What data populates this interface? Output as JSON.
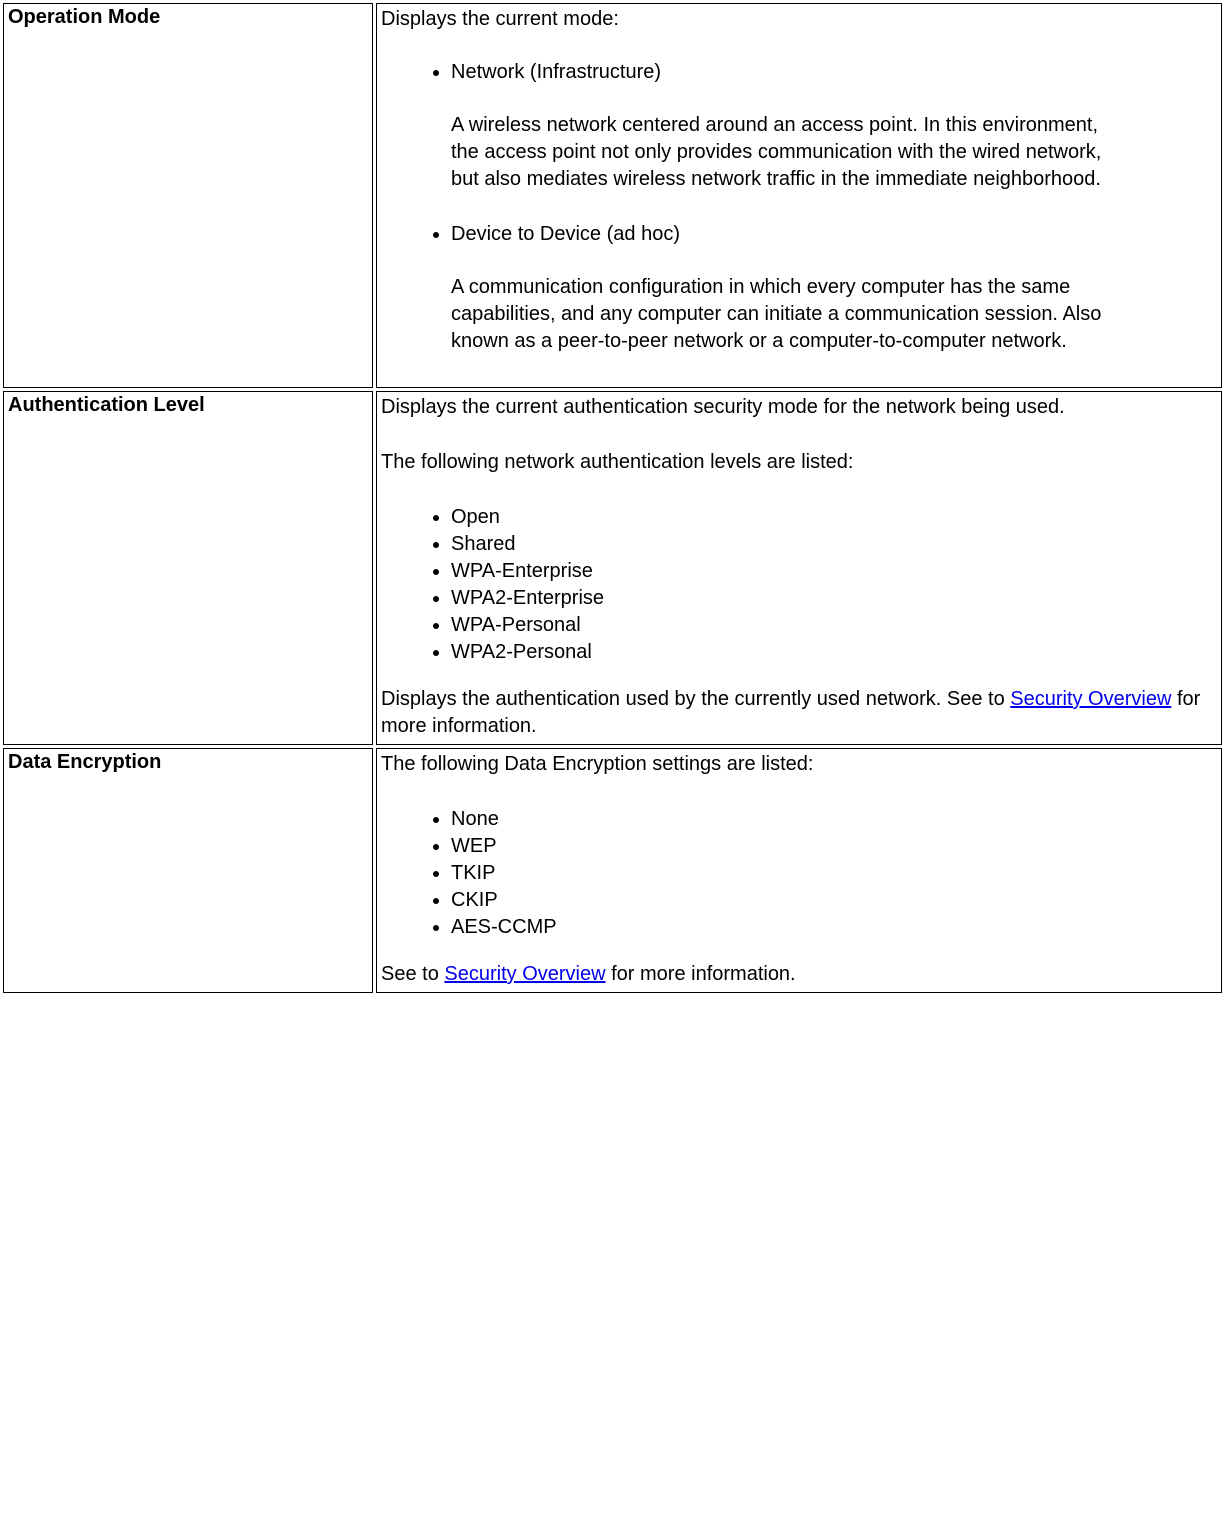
{
  "rows": [
    {
      "label": "Operation Mode",
      "intro": "Displays the current mode:",
      "items": [
        {
          "title": "Network (Infrastructure)",
          "desc": "A wireless network centered around an access point. In this environment, the access point not only provides communication with the wired network, but also mediates wireless network traffic in the immediate neighborhood."
        },
        {
          "title": "Device to Device (ad hoc)",
          "desc": "A communication configuration in which every computer has the same capabilities, and any computer can initiate a communication session. Also known as a peer-to-peer network or a computer-to-computer network."
        }
      ]
    },
    {
      "label": "Authentication Level",
      "intro": "Displays the current authentication security mode for the network being used.",
      "para2": "The following network authentication levels are listed:",
      "list": [
        "Open",
        "Shared",
        "WPA-Enterprise",
        "WPA2-Enterprise",
        "WPA-Personal",
        "WPA2-Personal"
      ],
      "outro_pre": "Displays the authentication used by the currently used network. See to ",
      "link": "Security Overview",
      "outro_post": " for more information."
    },
    {
      "label": "Data Encryption",
      "intro": "The following Data Encryption settings are listed:",
      "list": [
        "None",
        "WEP",
        "TKIP",
        "CKIP",
        "AES-CCMP"
      ],
      "outro_pre": "See to ",
      "link": "Security Overview",
      "outro_post": " for more information."
    }
  ]
}
